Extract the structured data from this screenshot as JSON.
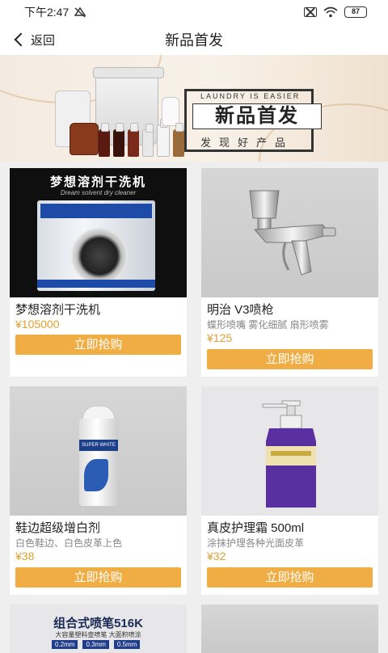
{
  "status": {
    "time": "下午2:47",
    "battery": "87"
  },
  "header": {
    "back_label": "返回",
    "title": "新品首发"
  },
  "banner": {
    "en_text": "LAUNDRY IS EASIER",
    "title": "新品首发",
    "subtitle": "发现好产品"
  },
  "products": [
    {
      "image_title": "梦想溶剂干洗机",
      "image_subtitle": "Dream solvent dry cleaner",
      "name": "梦想溶剂干洗机",
      "desc": "",
      "price": "¥105000",
      "buy": "立即抢购"
    },
    {
      "name": "明治 V3喷枪",
      "desc": "蝶形喷嘴 雾化细腻 扇形喷雾",
      "price": "¥125",
      "buy": "立即抢购"
    },
    {
      "name": "鞋边超级增白剂",
      "desc": "白色鞋边、白色皮革上色",
      "price": "¥38",
      "buy": "立即抢购",
      "can_label": "SUPER WHITE"
    },
    {
      "name": "真皮护理霜 500ml",
      "desc": "涂抹护理各种光面皮革",
      "price": "¥32",
      "buy": "立即抢购"
    },
    {
      "image_title": "组合式喷笔516K",
      "image_subtitle": "大容量塑料壶喷笔  大面积喷涂",
      "sizes": [
        "0.2mm",
        "0.3mm",
        "0.5mm"
      ]
    }
  ],
  "colors": {
    "accent": "#f0ad44",
    "price": "#e0a030"
  }
}
